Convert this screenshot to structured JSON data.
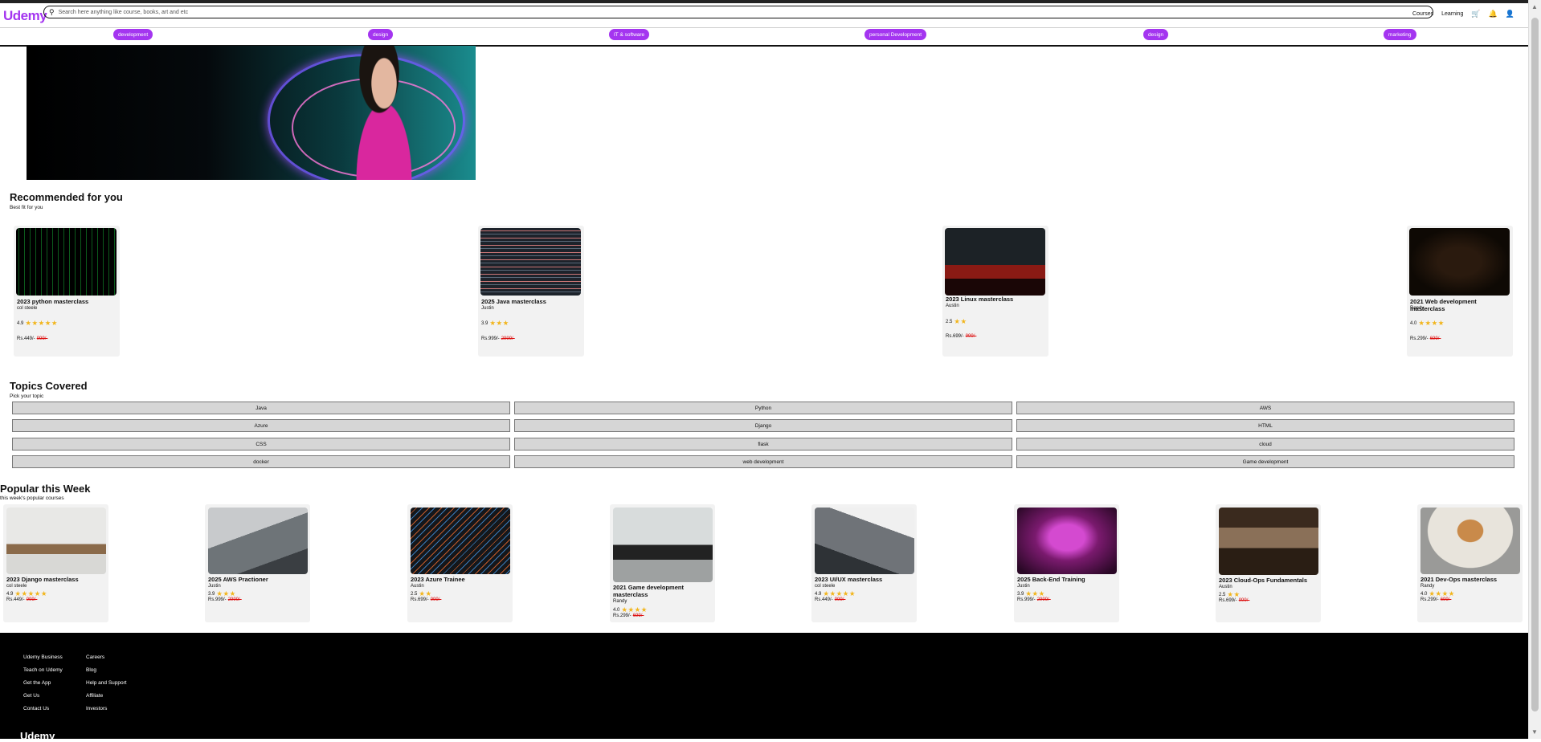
{
  "brand": {
    "logo": "Udemy",
    "accent": "#a435f0"
  },
  "search": {
    "placeholder": "Search here anything like course, books, art and etc"
  },
  "nav": {
    "courses": "Courses",
    "learning": "Learning",
    "icons": [
      "cart-icon",
      "bell-icon",
      "user-icon"
    ]
  },
  "categories": [
    "development",
    "design",
    "IT & software",
    "personal Development",
    "design",
    "marketing"
  ],
  "recommended": {
    "title": "Recommended for you",
    "subtitle": "Best fit for you",
    "cards": [
      {
        "title": "2023 python masterclass",
        "author": "col steele",
        "rating": "4.9",
        "stars": "★★★★★",
        "price": "Rs.449/-",
        "old_price": "999/-",
        "thumb": "#0a3b12"
      },
      {
        "title": "2025 Java masterclass",
        "author": "Justin",
        "rating": "3.9",
        "stars": "★★★",
        "price": "Rs.999/-",
        "old_price": "2999/-",
        "thumb": "#1d232b"
      },
      {
        "title": "2023 Linux masterclass",
        "author": "Austin",
        "rating": "2.5",
        "stars": "★★",
        "price": "Rs.699/-",
        "old_price": "999/-",
        "thumb": "#2a1010"
      },
      {
        "title": "2021 Web development masterclass",
        "author": "Randy",
        "rating": "4.0",
        "stars": "★★★★",
        "price": "Rs.299/-",
        "old_price": "699/-",
        "thumb": "#1e1206"
      }
    ]
  },
  "topics": {
    "title": "Topics Covered",
    "subtitle": "Pick your topic",
    "items": [
      "Java",
      "Python",
      "AWS",
      "Azure",
      "Django",
      "HTML",
      "CSS",
      "flask",
      "cloud",
      "docker",
      "web development",
      "Game development"
    ]
  },
  "popular": {
    "title": "Popular this Week",
    "subtitle": "this week's popular courses",
    "cards": [
      {
        "title": "2023 Django masterclass",
        "author": "col steele",
        "rating": "4.9",
        "stars": "★★★★★",
        "price": "Rs.449/-",
        "old_price": "999/-",
        "thumb": "#b7b8b5"
      },
      {
        "title": "2025 AWS Practioner",
        "author": "Justin",
        "rating": "3.9",
        "stars": "★★★",
        "price": "Rs.999/-",
        "old_price": "2999/-",
        "thumb": "#8a8f94"
      },
      {
        "title": "2023 Azure Trainee",
        "author": "Austin",
        "rating": "2.5",
        "stars": "★★",
        "price": "Rs.699/-",
        "old_price": "999/-",
        "thumb": "#1a1d22"
      },
      {
        "title": "2021 Game development masterclass",
        "author": "Randy",
        "rating": "4.0",
        "stars": "★★★★",
        "price": "Rs.299/-",
        "old_price": "699/-",
        "thumb": "#9ea1a1"
      },
      {
        "title": "2023 UI/UX masterclass",
        "author": "col steele",
        "rating": "4.9",
        "stars": "★★★★★",
        "price": "Rs.449/-",
        "old_price": "999/-",
        "thumb": "#6f7378"
      },
      {
        "title": "2025 Back-End Training",
        "author": "Justin",
        "rating": "3.9",
        "stars": "★★★",
        "price": "Rs.999/-",
        "old_price": "2999/-",
        "thumb": "#7a1a6e"
      },
      {
        "title": "2023 Cloud-Ops Fundamentals",
        "author": "Austin",
        "rating": "2.5",
        "stars": "★★",
        "price": "Rs.699/-",
        "old_price": "999/-",
        "thumb": "#5a4636"
      },
      {
        "title": "2021 Dev-Ops masterclass",
        "author": "Randy",
        "rating": "4.0",
        "stars": "★★★★",
        "price": "Rs.299/-",
        "old_price": "699/-",
        "thumb": "#c9c4bb"
      }
    ]
  },
  "footer": {
    "col1": [
      "Udemy Business",
      "Teach on Udemy",
      "Get the App",
      "Get Us",
      "Contact Us"
    ],
    "col2": [
      "Careers",
      "Blog",
      "Help and Support",
      "Affiliate",
      "Investors"
    ],
    "logo": "Udemy"
  }
}
